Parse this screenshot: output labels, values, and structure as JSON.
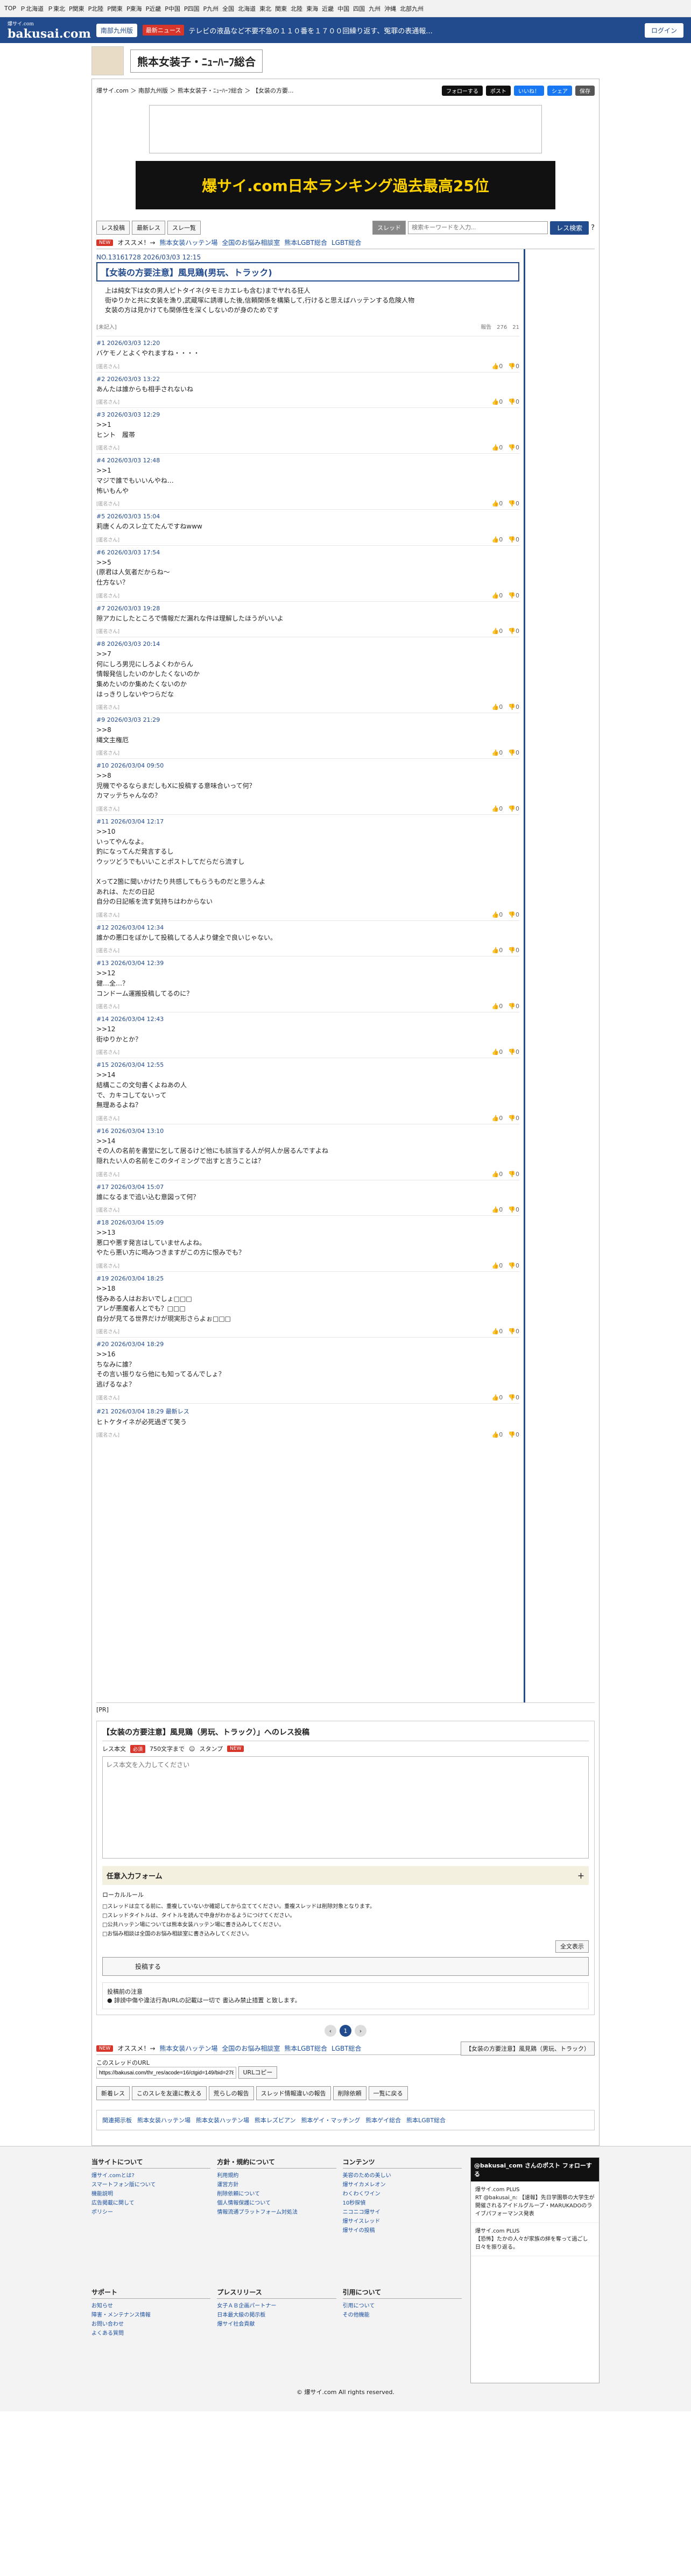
{
  "topnav": [
    "TOP",
    "Ｐ北海道",
    "Ｐ東北",
    "P関東",
    "P北陸",
    "P関東",
    "P東海",
    "P近畿",
    "P中国",
    "P四国",
    "P九州",
    "全国",
    "北海道",
    "東北",
    "関東",
    "北陸",
    "東海",
    "近畿",
    "中国",
    "四国",
    "九州",
    "沖縄",
    "北部九州"
  ],
  "header": {
    "logo": "bakusai.com",
    "logo_sub": "爆サイ.com",
    "region": "南部九州版",
    "news_tag": "最新ニュース",
    "news": "テレビの液晶など不要不急の１１０番を１７００回繰り返す、冤罪の表通報...",
    "login": "ログイン"
  },
  "board_title": "熊本女装子・ﾆｭｰﾊｰﾌ総合",
  "breadcrumb": "爆サイ.com ＞ 南部九州版 ＞ 熊本女装子・ﾆｭｰﾊｰﾌ総合 ＞ 【女装の方要...",
  "share": {
    "follow": "フォローする",
    "post": "ポスト",
    "like": "いいね！",
    "share": "シェア",
    "save": "保存"
  },
  "ad_text": "爆サイ.com日本ランキング過去最高25位",
  "toolbar": {
    "btn1": "レス投稿",
    "btn2": "最新レス",
    "btn3": "スレ一覧",
    "thread_sel": "スレッド",
    "search_ph": "検索キーワードを入力...",
    "search_btn": "レス検索"
  },
  "recommend": {
    "badge": "NEW",
    "label": "オススメ！→",
    "links": [
      "熊本女装ハッテン場",
      "全国のお悩み相談室",
      "熊本LGBT総合",
      "LGBT総合"
    ]
  },
  "op": {
    "meta": "NO.13161728 2026/03/03 12:15",
    "title": "【女装の方要注意】風見鶏(男玩、トラック)",
    "body": "上は純女下は女の男人ピトタイネ(タモミカエレも含む)までヤれる狂人\n街ゆりかと共に女装を漁り,武蔵塚に誘導した後,信頼関係を構築して,行けると思えばハッテンする危険人物\n女装の方は見かけても関係性を深くしないのが身のためです",
    "stats": "報告　276　21",
    "foot": "[未記入]"
  },
  "posts": [
    {
      "m": "#1 2026/03/03 12:20",
      "b": "バケモノとよくやれますね・・・・",
      "f": "[匿名さん]"
    },
    {
      "m": "#2 2026/03/03 13:22",
      "b": "あんたは誰からも相手されないね",
      "f": "[匿名さん]"
    },
    {
      "m": "#3 2026/03/03 12:29",
      "b": ">>1\nヒント　履帯",
      "f": "[匿名さん]"
    },
    {
      "m": "#4 2026/03/03 12:48",
      "b": ">>1\nマジで誰でもいいんやね…\n怖いもんや",
      "f": "[匿名さん]"
    },
    {
      "m": "#5 2026/03/03 15:04",
      "b": "莉唐くんのスレ立てたんですねwww",
      "f": "[匿名さん]"
    },
    {
      "m": "#6 2026/03/03 17:54",
      "b": ">>5\n(原君は人気者だからね〜\n仕方ない？",
      "f": "[匿名さん]"
    },
    {
      "m": "#7 2026/03/03 19:28",
      "b": "隙アカにしたところで情報だだ漏れな件は理解したほうがいいよ",
      "f": "[匿名さん]"
    },
    {
      "m": "#8 2026/03/03 20:14",
      "b": ">>7\n何にしろ男児にしろよくわからん\n情報発信したいのかしたくないのか\n集めたいのか集めたくないのか\nはっきりしないやつらだな",
      "f": "[匿名さん]"
    },
    {
      "m": "#9 2026/03/03 21:29",
      "b": ">>8\n縄文主権厄",
      "f": "[匿名さん]"
    },
    {
      "m": "#10 2026/03/04 09:50",
      "b": ">>8\n児機でやるならまだしもXに投稿する意味合いって何？\nカマッテちゃんなの？",
      "f": "[匿名さん]"
    },
    {
      "m": "#11 2026/03/04 12:17",
      "b": ">>10\nいってやんなよ。\n釣になってんだ発言するし\nウッツどうでもいいことポストしてだらだら流すし\n\nXって2箇に聞いかけたり共感してもらうものだと思うんよ\nあれは、ただの日記\n自分の日記帳を流す気持ちはわからない",
      "f": "[匿名さん]"
    },
    {
      "m": "#12 2026/03/04 12:34",
      "b": "誰かの悪口をぼかして投稿してる人より健全で良いじゃない。",
      "f": "[匿名さん]"
    },
    {
      "m": "#13 2026/03/04 12:39",
      "b": ">>12\n健…全…？\nコンドーム運搬投稿してるのに？",
      "f": "[匿名さん]"
    },
    {
      "m": "#14 2026/03/04 12:43",
      "b": ">>12\n街ゆりかとか？",
      "f": "[匿名さん]"
    },
    {
      "m": "#15 2026/03/04 12:55",
      "b": ">>14\n結構ここの文句書くよねあの人\nで、カキコしてないって\n無理あるよね？",
      "f": "[匿名さん]"
    },
    {
      "m": "#16 2026/03/04 13:10",
      "b": ">>14\nその人の名前を書堂に乞して居るけど他にも該当する人が何人か居るんですよね\n隠れたい人の名前をこのタイミングで出すと言うことは？",
      "f": "[匿名さん]"
    },
    {
      "m": "#17 2026/03/04 15:07",
      "b": "誰になるまで追い込む意図って何？",
      "f": "[匿名さん]"
    },
    {
      "m": "#18 2026/03/04 15:09",
      "b": ">>13\n悪口や悪す発言はしていませんよね。\nやたら悪い方に喝みつきますがこの方に恨みでも？",
      "f": "[匿名さん]"
    },
    {
      "m": "#19 2026/03/04 18:25",
      "b": ">>18\n怪みある人はおおいでしょ□□□\nアレが悪魔者人とでも？□□□\n自分が見てる世界だけが現実形さらよぉ□□□",
      "f": "[匿名さん]"
    },
    {
      "m": "#20 2026/03/04 18:29",
      "b": ">>16\nちなみに誰？\nその言い振りなら他にも知ってるんでしょ？\n逃げるなよ？",
      "f": "[匿名さん]"
    },
    {
      "m": "#21 2026/03/04 18:29 最新レス",
      "b": "ヒトケタイネが必死過ぎて笑う",
      "f": "[匿名さん]"
    }
  ],
  "pr": "[PR]",
  "form": {
    "head": "【女装の方要注意】風見鶏（男玩、トラック）」へのレス投稿",
    "label": "レス本文",
    "req": "必須",
    "count": "750文字まで",
    "stamp": "スタンプ",
    "new": "NEW",
    "ph": "レス本文を入力してください",
    "options": "任意入力フォーム",
    "local": "ローカルルール",
    "rules": "□スレッドは立てる前に、重複していないか確認してから立ててください。重複スレッドは削除対象となります。\n□スレッドタイトルは、タイトルを読んで中身がわかるようにつけてください。\n□公共ハッテン場については熊本女装ハッテン場に書き込みしてください。\n□お悩み相談は全国のお悩み相談室に書き込みしてください。",
    "fulltext": "全文表示",
    "submit": "投稿する",
    "note_head": "投稿前の注意",
    "note": "● 誹謗中傷や違法行為URLの記載は一切で 書込み禁止措置 と致します。"
  },
  "pager": {
    "prev": "‹",
    "cur": "1",
    "next": "›"
  },
  "bottom": {
    "thread": "【女装の方要注意】風見鶏（男玩、トラック）",
    "url_label": "このスレッドのURL",
    "url": "https://bakusai.com/thr_res/acode=16/ctgid=149/bid=2787/tid=13",
    "copy": "URLコピー"
  },
  "actions": [
    "新着レス",
    "このスレを友達に教える",
    "荒らしの報告",
    "スレッド情報違いの報告",
    "削除依頼",
    "一覧に戻る"
  ],
  "links": [
    "関連掲示板",
    "熊本女装ハッテン場",
    "熊本女装ハッテン場",
    "熊本レズビアン",
    "熊本ゲイ・マッチング",
    "熊本ゲイ総合",
    "熊本LGBT総合"
  ],
  "footer": {
    "cols": [
      {
        "h": "当サイトについて",
        "i": [
          "爆サイ.comとは?",
          "スマートフォン版について",
          "機能説明",
          "広告掲載に関して",
          "ポリシー"
        ]
      },
      {
        "h": "方針・規約について",
        "i": [
          "利用規約",
          "運営方針",
          "削除依頼について",
          "個人情報保護について",
          "情報流通プラットフォーム対処法"
        ]
      },
      {
        "h": "コンテンツ",
        "i": [
          "美容のための美しい",
          "爆サイカメレオン",
          "わくわくワイン",
          "10秒探偵",
          "ニコニコ爆サイ",
          "爆サイスレッド",
          "爆サイの投稿"
        ]
      },
      {
        "h": "サポート",
        "i": [
          "お知らせ",
          "障害・メンテナンス情報",
          "お問い合わせ",
          "よくある質問"
        ]
      },
      {
        "h": "プレスリリース",
        "i": [
          "女子ＡＢ企画パートナー",
          "日本最大級の掲示板",
          "爆サイ社会貢献"
        ]
      },
      {
        "h": "引用について",
        "i": [
          "引用について",
          "その他機能"
        ]
      }
    ],
    "tw_head": "@bakusai_com さんのポスト",
    "tw_follow": "フォローする",
    "tw1": "爆サイ.com PLUS\nRT @bakusai_n: 【速報】先日学園祭の大学生が開催されるアイドルグループ・MARUKADOのライブパフォーマンス発表",
    "tw2": "爆サイ.com PLUS\n【恐怖】たかの人々が家族の絆を奪って過ごし日々を振り返る。",
    "copy": "© 爆サイ.com All rights reserved."
  }
}
